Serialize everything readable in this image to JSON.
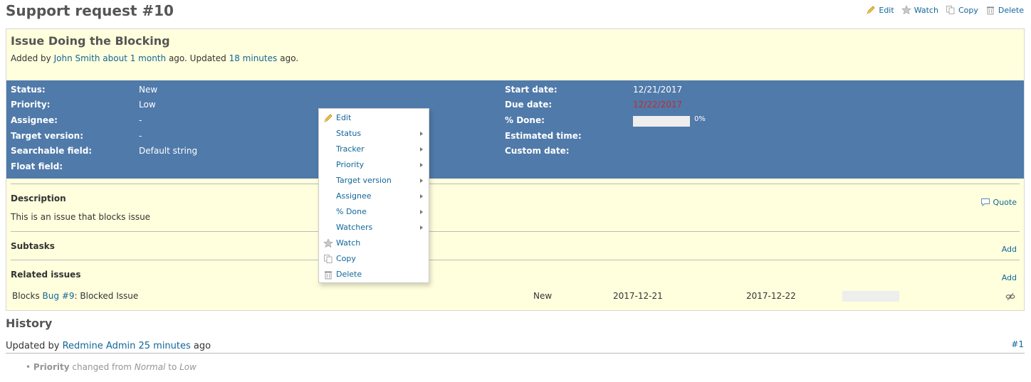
{
  "page": {
    "title": "Support request #10",
    "actions": {
      "edit": "Edit",
      "watch": "Watch",
      "copy": "Copy",
      "delete": "Delete"
    }
  },
  "issue": {
    "subject": "Issue Doing the Blocking",
    "author_prefix": "Added by",
    "author": "John Smith",
    "added_ago": "about 1 month",
    "mid_text": "ago. Updated",
    "updated_ago": "18 minutes",
    "suffix": "ago."
  },
  "attributes": {
    "left": [
      {
        "label": "Status:",
        "value": "New"
      },
      {
        "label": "Priority:",
        "value": "Low"
      },
      {
        "label": "Assignee:",
        "value": "-"
      },
      {
        "label": "Target version:",
        "value": "-"
      },
      {
        "label": "Searchable field:",
        "value": "Default string"
      },
      {
        "label": "Float field:",
        "value": ""
      }
    ],
    "right": [
      {
        "label": "Start date:",
        "value": "12/21/2017"
      },
      {
        "label": "Due date:",
        "value": "12/22/2017"
      },
      {
        "label": "% Done:",
        "value": "0%"
      },
      {
        "label": "Estimated time:",
        "value": ""
      },
      {
        "label": "Custom date:",
        "value": ""
      }
    ],
    "done_ratio": 0,
    "overdue_color": "#c22d2d"
  },
  "description": {
    "title": "Description",
    "quote": "Quote",
    "text": "This is an issue that blocks issue"
  },
  "subtasks": {
    "title": "Subtasks",
    "add": "Add"
  },
  "relations": {
    "title": "Related issues",
    "add": "Add",
    "rows": [
      {
        "relation": "Blocks",
        "issue_link": "Bug #9",
        "subject": ": Blocked Issue",
        "status": "New",
        "start": "2017-12-21",
        "due": "2017-12-22",
        "done_ratio": 0
      }
    ]
  },
  "history": {
    "title": "History",
    "journal": {
      "prefix": "Updated by",
      "user": "Redmine Admin",
      "ago": "25 minutes",
      "suffix": "ago",
      "number": "#1",
      "detail_field": "Priority",
      "detail_text1": "changed from",
      "old_value": "Normal",
      "detail_text2": "to",
      "new_value": "Low"
    }
  },
  "context_menu": {
    "items": [
      {
        "label": "Edit",
        "icon": "pencil-icon",
        "submenu": false
      },
      {
        "label": "Status",
        "icon": "",
        "submenu": true
      },
      {
        "label": "Tracker",
        "icon": "",
        "submenu": true
      },
      {
        "label": "Priority",
        "icon": "",
        "submenu": true
      },
      {
        "label": "Target version",
        "icon": "",
        "submenu": true
      },
      {
        "label": "Assignee",
        "icon": "",
        "submenu": true
      },
      {
        "label": "% Done",
        "icon": "",
        "submenu": true
      },
      {
        "label": "Watchers",
        "icon": "",
        "submenu": true
      },
      {
        "label": "Watch",
        "icon": "star-icon",
        "submenu": false
      },
      {
        "label": "Copy",
        "icon": "copy-icon",
        "submenu": false
      },
      {
        "label": "Delete",
        "icon": "trash-icon",
        "submenu": false
      }
    ]
  },
  "colors": {
    "link": "#116699",
    "attributes_bg": "#507aaa",
    "issue_bg": "#ffffdd"
  }
}
